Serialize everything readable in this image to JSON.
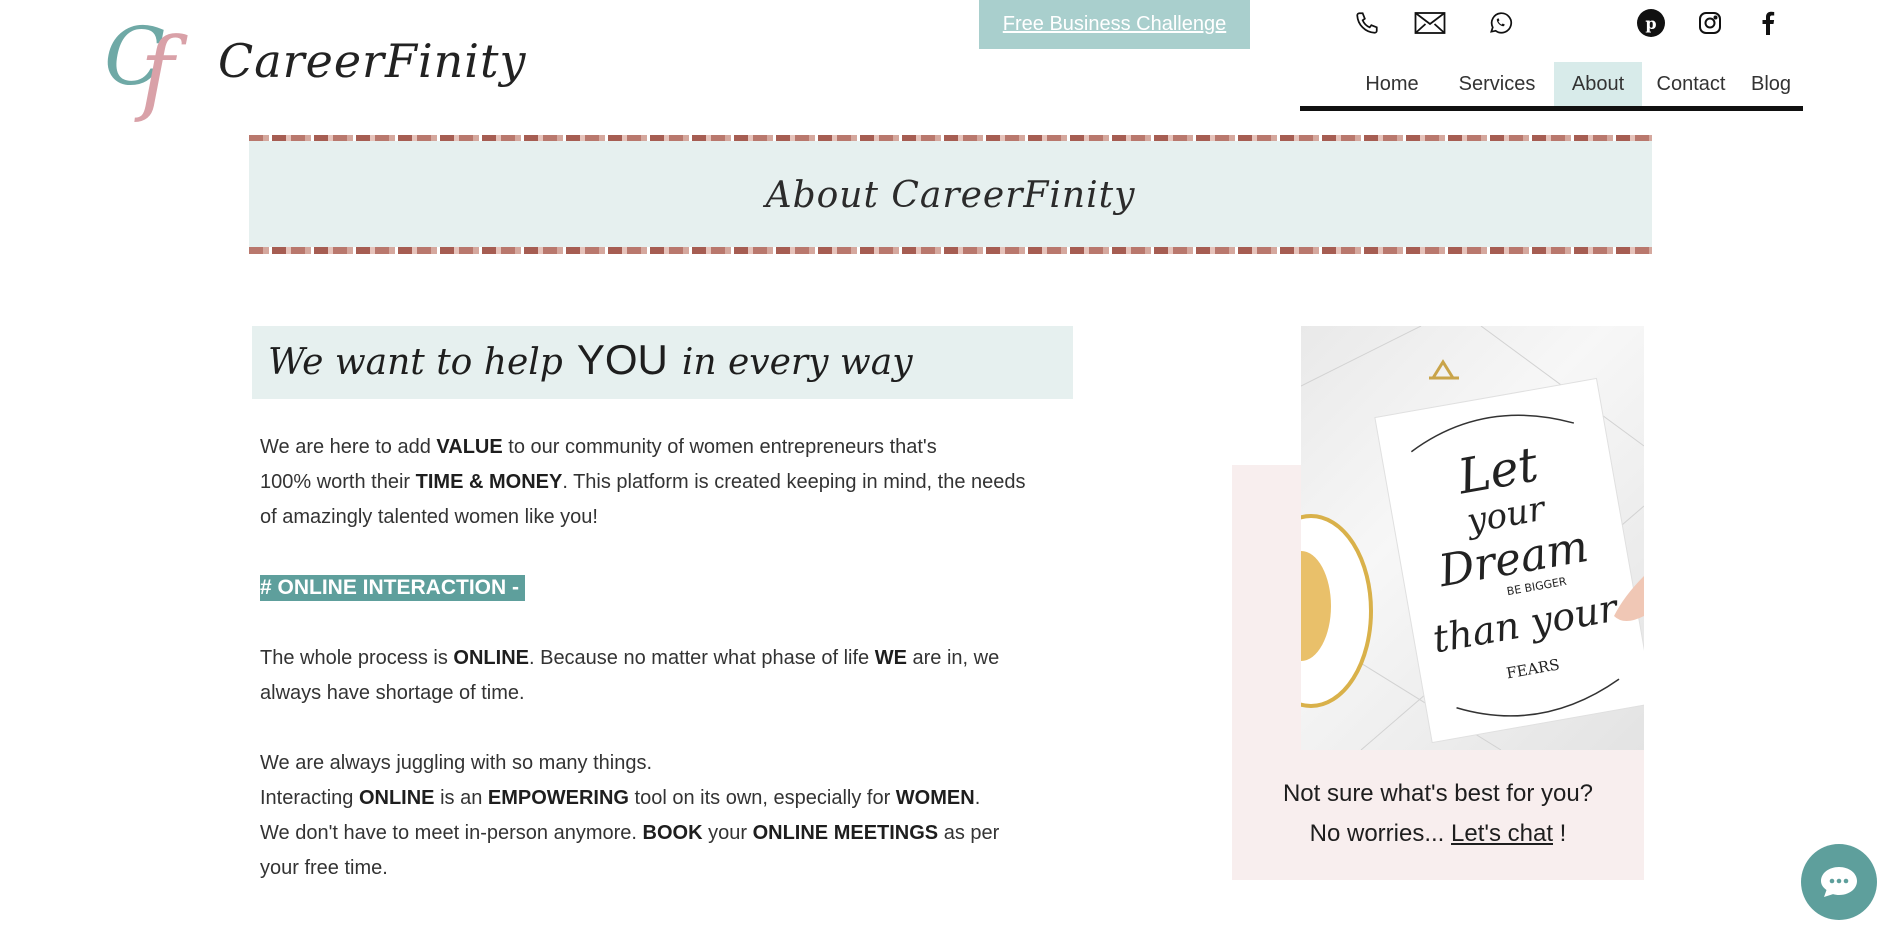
{
  "header": {
    "logo_letters": "Cf",
    "brand_name": "CareerFinity",
    "cta_label": "Free Business Challenge",
    "contact_icons": [
      "phone-icon",
      "mail-icon",
      "whatsapp-icon"
    ],
    "social_icons": [
      "pinterest-icon",
      "instagram-icon",
      "facebook-icon"
    ],
    "nav": [
      {
        "label": "Home",
        "active": false
      },
      {
        "label": "Services",
        "active": false
      },
      {
        "label": "About",
        "active": true
      },
      {
        "label": "Contact",
        "active": false
      },
      {
        "label": "Blog",
        "active": false
      }
    ]
  },
  "banner": {
    "title": "About  CareerFinity"
  },
  "intro": {
    "heading_start": "We want to help",
    "heading_emph": "YOU",
    "heading_end": "in every way",
    "p1_a": "We are here to add ",
    "p1_b": "VALUE",
    "p1_c": " to our community of women entrepreneurs that's",
    "p1_d": "100% worth their ",
    "p1_e": "TIME & MONEY",
    "p1_f": ".  This platform is created keeping in mind, the needs",
    "p1_g": "of amazingly talented women like you!",
    "highlight": "# ONLINE INTERACTION -",
    "p2_a": "The whole process is ",
    "p2_b": "ONLINE",
    "p2_c": ". Because no matter what phase of life ",
    "p2_d": "WE",
    "p2_e": " are in, we",
    "p2_f": "always have shortage of time.",
    "p3_a": "We are always juggling with so many things.",
    "p3_b": "Interacting ",
    "p3_c": "ONLINE",
    "p3_d": " is an ",
    "p3_e": "EMPOWERING",
    "p3_f": " tool on its own, especially for ",
    "p3_g": "WOMEN",
    "p3_h": ".",
    "p3_i": "We don't have to meet in-person anymore. ",
    "p3_j": "BOOK",
    "p3_k": " your ",
    "p3_l": "ONLINE MEETINGS",
    "p3_m": " as per",
    "p3_n": "your free time."
  },
  "card": {
    "image_alt": "Let your dream be bigger than your fears",
    "poster_line1": "Let",
    "poster_line2": "your",
    "poster_line3": "Dream",
    "poster_line4": "BE BIGGER",
    "poster_line5": "than your",
    "poster_line6": "FEARS",
    "question": "Not sure what's best for you?",
    "reply_a": "No worries... ",
    "reply_link": "Let's chat",
    "reply_b": " !"
  },
  "colors": {
    "accent": "#5e9f9c",
    "cta_bg": "#a9cfcd",
    "banner_bg": "#e6f0ef",
    "card_bg": "#f8eeee",
    "logo_teal": "#6fa9a6",
    "logo_pink": "#d9a1a8"
  }
}
